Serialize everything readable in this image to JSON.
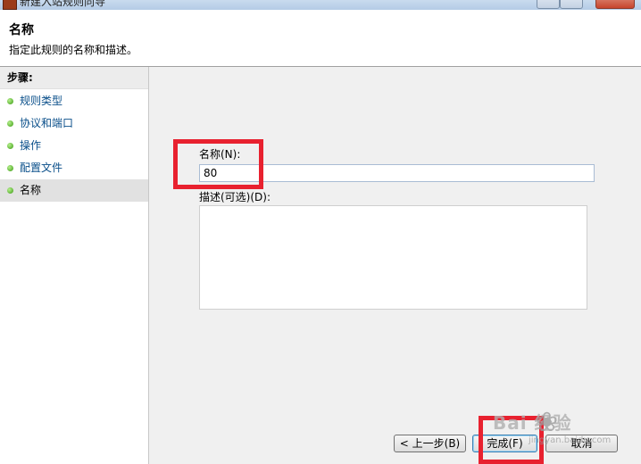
{
  "window": {
    "title": "新建入站规则向导"
  },
  "header": {
    "title": "名称",
    "description": "指定此规则的名称和描述。"
  },
  "steps": {
    "title": "步骤:",
    "items": [
      {
        "label": "规则类型",
        "active": false
      },
      {
        "label": "协议和端口",
        "active": false
      },
      {
        "label": "操作",
        "active": false
      },
      {
        "label": "配置文件",
        "active": false
      },
      {
        "label": "名称",
        "active": true
      }
    ]
  },
  "form": {
    "name_label": "名称(N):",
    "name_value": "80",
    "desc_label": "描述(可选)(D):",
    "desc_value": ""
  },
  "buttons": {
    "back": "< 上一步(B)",
    "finish": "完成(F)",
    "cancel": "取消"
  },
  "watermark": {
    "brand": "Bai  经验",
    "url": "jingyan.baidu.com"
  },
  "colors": {
    "highlight": "#e8212f",
    "step_link": "#0a4f8a"
  }
}
